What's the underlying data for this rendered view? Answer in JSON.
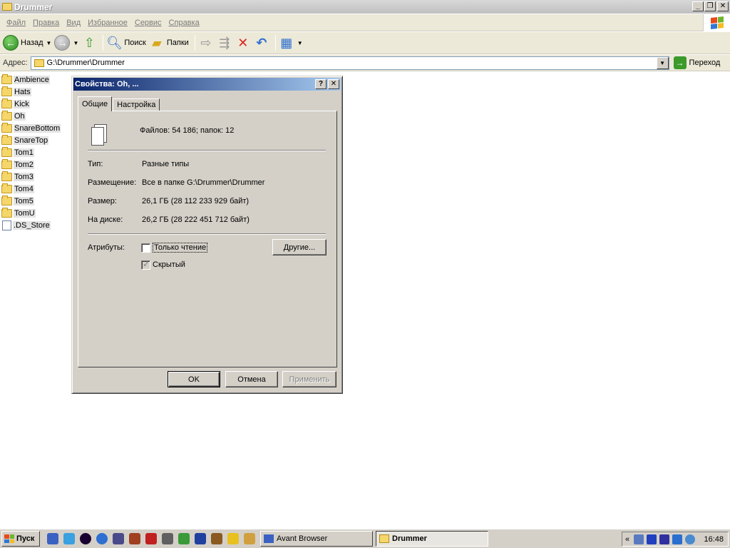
{
  "window": {
    "title": "Drummer"
  },
  "menu": [
    "Файл",
    "Правка",
    "Вид",
    "Избранное",
    "Сервис",
    "Справка"
  ],
  "toolbar": {
    "back_label": "Назад",
    "search_label": "Поиск",
    "folders_label": "Папки"
  },
  "address": {
    "label": "Адрес:",
    "value": "G:\\Drummer\\Drummer",
    "go_label": "Переход"
  },
  "files": [
    {
      "name": "Ambience",
      "type": "folder"
    },
    {
      "name": "Hats",
      "type": "folder"
    },
    {
      "name": "Kick",
      "type": "folder"
    },
    {
      "name": "Oh",
      "type": "folder"
    },
    {
      "name": "SnareBottom",
      "type": "folder"
    },
    {
      "name": "SnareTop",
      "type": "folder"
    },
    {
      "name": "Tom1",
      "type": "folder"
    },
    {
      "name": "Tom2",
      "type": "folder"
    },
    {
      "name": "Tom3",
      "type": "folder"
    },
    {
      "name": "Tom4",
      "type": "folder"
    },
    {
      "name": "Tom5",
      "type": "folder"
    },
    {
      "name": "TomU",
      "type": "folder"
    },
    {
      "name": ".DS_Store",
      "type": "file"
    }
  ],
  "dialog": {
    "title": "Свойства: Oh, ...",
    "tabs": {
      "general": "Общие",
      "settings": "Настройка"
    },
    "summary": "Файлов: 54 186; папок: 12",
    "type_label": "Тип:",
    "type_value": "Разные типы",
    "location_label": "Размещение:",
    "location_value": "Все в папке G:\\Drummer\\Drummer",
    "size_label": "Размер:",
    "size_value": "26,1 ГБ (28 112 233 929 байт)",
    "disk_label": "На диске:",
    "disk_value": "26,2 ГБ (28 222 451 712 байт)",
    "attributes_label": "Атрибуты:",
    "readonly_label": "Только чтение",
    "hidden_label": "Скрытый",
    "other_button": "Другие...",
    "ok": "OK",
    "cancel": "Отмена",
    "apply": "Применить"
  },
  "taskbar": {
    "start": "Пуск",
    "tasks": {
      "avant": "Avant Browser",
      "drummer": "Drummer"
    },
    "clock": "16:48",
    "tray_expand": "«"
  },
  "colors": {
    "dialog_title_start": "#0a246a",
    "dialog_title_end": "#a6caf0",
    "face": "#d4d0c8"
  }
}
